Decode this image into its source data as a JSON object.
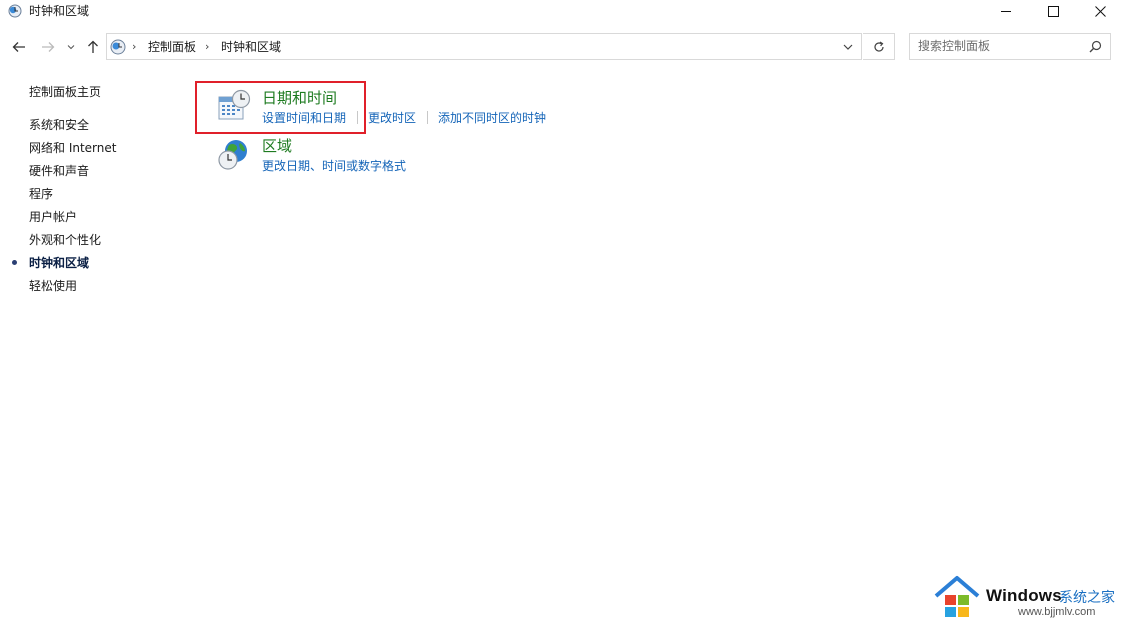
{
  "window": {
    "title": "时钟和区域",
    "icon": "control-panel-clock-icon"
  },
  "address": {
    "breadcrumbs": [
      "控制面板",
      "时钟和区域"
    ]
  },
  "search": {
    "placeholder": "搜索控制面板"
  },
  "sidebar": {
    "items": [
      {
        "label": "控制面板主页"
      },
      {
        "label": "系统和安全"
      },
      {
        "label": "网络和 Internet"
      },
      {
        "label": "硬件和声音"
      },
      {
        "label": "程序"
      },
      {
        "label": "用户帐户"
      },
      {
        "label": "外观和个性化"
      },
      {
        "label": "时钟和区域",
        "active": true
      },
      {
        "label": "轻松使用"
      }
    ]
  },
  "categories": [
    {
      "title": "日期和时间",
      "icon": "calendar-clock-icon",
      "links": [
        "设置时间和日期",
        "更改时区",
        "添加不同时区的时钟"
      ]
    },
    {
      "title": "区域",
      "icon": "globe-clock-icon",
      "links": [
        "更改日期、时间或数字格式"
      ]
    }
  ],
  "watermark": {
    "brand": "Windows",
    "site": "系统之家",
    "url": "www.bjjmlv.com"
  },
  "colors": {
    "category_title": "#1e7b20",
    "link": "#1565b8",
    "highlight_border": "#e0202a"
  }
}
